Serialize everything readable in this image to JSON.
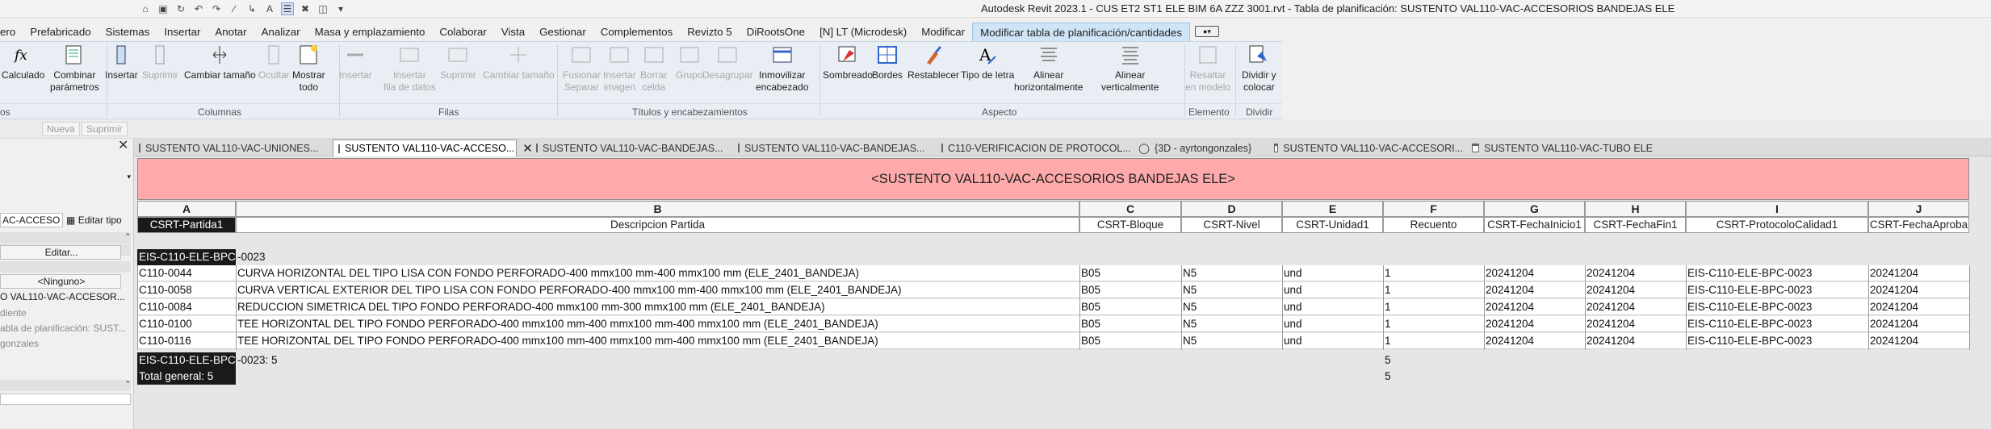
{
  "window": {
    "title": "Autodesk Revit 2023.1 - CUS ET2 ST1 ELE BIM 6A ZZZ 3001.rvt - Tabla de planificación: SUSTENTO VAL110-VAC-ACCESORIOS BANDEJAS ELE"
  },
  "qat_icons": [
    "home-icon",
    "save-icon",
    "sync-icon",
    "undo-icon",
    "redo-icon",
    "measure-icon",
    "text-icon",
    "schedule-icon",
    "close-hidden-icon",
    "switch-windows-icon",
    "dropdown-icon"
  ],
  "menu": {
    "items": [
      "ero",
      "Prefabricado",
      "Sistemas",
      "Insertar",
      "Anotar",
      "Analizar",
      "Masa y emplazamiento",
      "Colaborar",
      "Vista",
      "Gestionar",
      "Complementos",
      "Revizto 5",
      "DiRootsOne",
      "[N] LT (Microdesk)",
      "Modificar"
    ],
    "active": "Modificar tabla de planificación/cantidades"
  },
  "ribbon": {
    "tools": [
      {
        "name": "calculado",
        "label": "Calculado",
        "icon": "fx-icon",
        "enabled": true
      },
      {
        "name": "combinar",
        "label": "Combinar\nparámetros",
        "icon": "combine-params-icon",
        "enabled": true
      },
      {
        "name": "insertar-col",
        "label": "Insertar",
        "icon": "insert-column-icon",
        "enabled": true
      },
      {
        "name": "suprimir-col",
        "label": "Suprimir",
        "icon": "delete-column-icon",
        "enabled": false
      },
      {
        "name": "cambiar-tamano-col",
        "label": "Cambiar tamaño",
        "icon": "resize-column-icon",
        "enabled": true
      },
      {
        "name": "ocultar",
        "label": "Ocultar",
        "icon": "hide-column-icon",
        "enabled": false
      },
      {
        "name": "mostrar-todo",
        "label": "Mostrar\ntodo",
        "icon": "show-all-icon",
        "enabled": true
      },
      {
        "name": "insertar-fila",
        "label": "Insertar",
        "icon": "insert-row-icon",
        "enabled": false
      },
      {
        "name": "insertar-fila-datos",
        "label": "Insertar\nfila de datos",
        "icon": "insert-data-row-icon",
        "enabled": false
      },
      {
        "name": "suprimir-fila",
        "label": "Suprimir",
        "icon": "delete-row-icon",
        "enabled": false
      },
      {
        "name": "cambiar-tamano-fila",
        "label": "Cambiar tamaño",
        "icon": "resize-row-icon",
        "enabled": false
      },
      {
        "name": "fusionar",
        "label": "Fusionar\nSeparar",
        "icon": "merge-icon",
        "enabled": false
      },
      {
        "name": "insertar-imagen",
        "label": "Insertar\nimagen",
        "icon": "insert-image-icon",
        "enabled": false
      },
      {
        "name": "borrar-celda",
        "label": "Borrar\ncelda",
        "icon": "clear-cell-icon",
        "enabled": false
      },
      {
        "name": "grupo",
        "label": "Grupo",
        "icon": "group-icon",
        "enabled": false
      },
      {
        "name": "desagrupar",
        "label": "Desagrupar",
        "icon": "ungroup-icon",
        "enabled": false
      },
      {
        "name": "inmovilizar",
        "label": "Inmovilizar\nencabezado",
        "icon": "freeze-header-icon",
        "enabled": true
      },
      {
        "name": "sombreado",
        "label": "Sombreado",
        "icon": "shading-icon",
        "enabled": true
      },
      {
        "name": "bordes",
        "label": "Bordes",
        "icon": "borders-icon",
        "enabled": true
      },
      {
        "name": "restablecer",
        "label": "Restablecer",
        "icon": "reset-brush-icon",
        "enabled": true
      },
      {
        "name": "tipo-letra",
        "label": "Tipo de letra",
        "icon": "font-icon",
        "enabled": true
      },
      {
        "name": "alinear-h",
        "label": "Alinear\nhorizontalmente",
        "icon": "align-horizontal-icon",
        "enabled": true
      },
      {
        "name": "alinear-v",
        "label": "Alinear\nverticalmente",
        "icon": "align-vertical-icon",
        "enabled": true
      },
      {
        "name": "resaltar",
        "label": "Resaltar\nen modelo",
        "icon": "highlight-in-model-icon",
        "enabled": false
      },
      {
        "name": "dividir",
        "label": "Dividir y\ncolocar",
        "icon": "split-place-icon",
        "enabled": true
      }
    ],
    "panels": [
      "os",
      "Columnas",
      "Filas",
      "Títulos y encabezamientos",
      "Aspecto",
      "Elemento",
      "Dividir"
    ]
  },
  "optbar": {
    "nueva": "Nueva",
    "suprimir": "Suprimir"
  },
  "props": {
    "type_value": "AC-ACCESO",
    "edit_type": "Editar tipo",
    "edit_button": "Editar...",
    "ninguno": "<Ninguno>",
    "view_name": "O VAL110-VAC-ACCESOR...",
    "dependency": "diente",
    "title_ref": "abla de planificación: SUST...",
    "user": "gonzales"
  },
  "doc_tabs": [
    {
      "label": "SUSTENTO VAL110-VAC-UNIONES...",
      "active": false
    },
    {
      "label": "SUSTENTO VAL110-VAC-ACCESO...",
      "active": true
    },
    {
      "label": "SUSTENTO VAL110-VAC-BANDEJAS...",
      "active": false
    },
    {
      "label": "SUSTENTO VAL110-VAC-BANDEJAS...",
      "active": false
    },
    {
      "label": "C110-VERIFICACION DE PROTOCOL...",
      "active": false
    },
    {
      "label": "{3D - ayrtongonzales}",
      "active": false
    },
    {
      "label": "SUSTENTO VAL110-VAC-ACCESORI...",
      "active": false
    },
    {
      "label": "SUSTENTO VAL110-VAC-TUBO ELE",
      "active": false
    }
  ],
  "schedule": {
    "title": "<SUSTENTO VAL110-VAC-ACCESORIOS BANDEJAS ELE>",
    "column_letters": [
      "A",
      "B",
      "C",
      "D",
      "E",
      "F",
      "G",
      "H",
      "I",
      "J"
    ],
    "field_headers": [
      "CSRT-Partida1",
      "Descripcion Partida",
      "CSRT-Bloque",
      "CSRT-Nivel",
      "CSRT-Unidad1",
      "Recuento",
      "CSRT-FechaInicio1",
      "CSRT-FechaFin1",
      "CSRT-ProtocoloCalidad1",
      "CSRT-FechaAproba"
    ],
    "group_header": "EIS-C110-ELE-BPC-0023",
    "rows": [
      [
        "C110-0044",
        "CURVA HORIZONTAL DEL TIPO LISA CON FONDO PERFORADO-400 mmx100 mm-400 mmx100 mm (ELE_2401_BANDEJA)",
        "B05",
        "N5",
        "und",
        "1",
        "20241204",
        "20241204",
        "EIS-C110-ELE-BPC-0023",
        "20241204"
      ],
      [
        "C110-0058",
        "CURVA VERTICAL EXTERIOR DEL TIPO LISA CON FONDO PERFORADO-400 mmx100 mm-400 mmx100 mm (ELE_2401_BANDEJA)",
        "B05",
        "N5",
        "und",
        "1",
        "20241204",
        "20241204",
        "EIS-C110-ELE-BPC-0023",
        "20241204"
      ],
      [
        "C110-0084",
        "REDUCCION SIMETRICA DEL TIPO FONDO PERFORADO-400 mmx100 mm-300 mmx100 mm (ELE_2401_BANDEJA)",
        "B05",
        "N5",
        "und",
        "1",
        "20241204",
        "20241204",
        "EIS-C110-ELE-BPC-0023",
        "20241204"
      ],
      [
        "C110-0100",
        "TEE HORIZONTAL DEL TIPO FONDO PERFORADO-400 mmx100 mm-400 mmx100 mm-400 mmx100 mm (ELE_2401_BANDEJA)",
        "B05",
        "N5",
        "und",
        "1",
        "20241204",
        "20241204",
        "EIS-C110-ELE-BPC-0023",
        "20241204"
      ],
      [
        "C110-0116",
        "TEE HORIZONTAL DEL TIPO FONDO PERFORADO-400 mmx100 mm-400 mmx100 mm-400 mmx100 mm (ELE_2401_BANDEJA)",
        "B05",
        "N5",
        "und",
        "1",
        "20241204",
        "20241204",
        "EIS-C110-ELE-BPC-0023",
        "20241204"
      ]
    ],
    "group_footer": "EIS-C110-ELE-BPC-0023: 5",
    "group_footer_count": "5",
    "grand_total": "Total general: 5",
    "grand_total_count": "5"
  },
  "colors": {
    "title_bg": "#ffaaaa",
    "selected_bg": "#1a1a1a",
    "ribbon_bg": "#e9eef4",
    "active_tab": "#cfe4f7"
  }
}
